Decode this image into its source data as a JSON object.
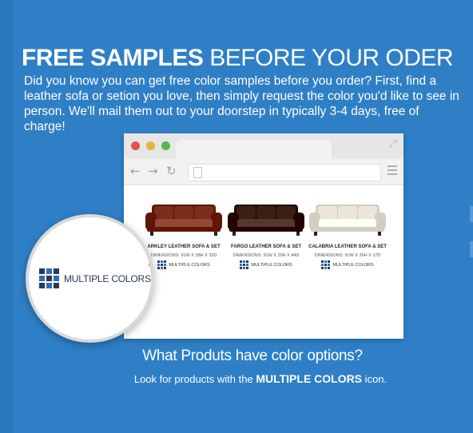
{
  "headline": {
    "bold": "FREE SAMPLES",
    "light": " BEFORE YOUR ODER"
  },
  "intro": "Did you know you can get free color samples before you order? First, find a leather sofa or setion you love, then simply request the color you'd like to see in person. We'll mail them out to your doorstep in typically 3-4 days, free of charge!",
  "browser": {
    "products": [
      {
        "name": "ARKLEY LEATHER SOFA & SET",
        "dimensions": "DIMENSIONS: 91W X 38H X 33D",
        "badge": "MULTIPLE COLORS",
        "color": "#7a2e1c"
      },
      {
        "name": "FARGO LEATHER SOFA & SET",
        "dimensions": "DIMENSIONS: 91W X 29H X 44D",
        "badge": "MULTIPLE COLORS",
        "color": "#3b1e14"
      },
      {
        "name": "CALABRIA LEATHER SOFA & SET",
        "dimensions": "DIMENSIONS: 91W X 36H X 37D",
        "badge": "MULTIPLE COLORS",
        "color": "#ede6da"
      }
    ]
  },
  "magnifier": {
    "edge_text": "RKLEY LEATHER SOFA & SET",
    "label": "MULTIPLE COLORS"
  },
  "footer": {
    "heading": "What Produts have color options?",
    "sub_before": "Look for products with the ",
    "sub_emphasis": "MULTIPLE COLORS",
    "sub_after": " icon."
  },
  "colors": {
    "background": "#2f7fc6",
    "grid_dark": "#2a3a55",
    "grid_blue": "#2f6fb5"
  }
}
